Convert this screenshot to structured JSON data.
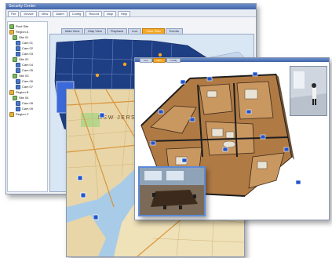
{
  "back_window": {
    "title": "Security Center",
    "toolbar_buttons": [
      "File",
      "Device",
      "View",
      "Alarm",
      "Config",
      "Record",
      "Map",
      "Help"
    ],
    "tabs": [
      "Main View",
      "Map View",
      "Playback",
      "Live",
      "Floor Plan",
      "Events"
    ],
    "active_tab_index": 4,
    "tree": [
      {
        "label": "Root Site",
        "type": "site"
      },
      {
        "label": "Region A",
        "type": "folder"
      },
      {
        "label": "Site 01",
        "type": "site"
      },
      {
        "label": "Cam 01",
        "type": "cam"
      },
      {
        "label": "Cam 02",
        "type": "cam"
      },
      {
        "label": "Cam 03",
        "type": "cam"
      },
      {
        "label": "Site 02",
        "type": "site"
      },
      {
        "label": "Cam 04",
        "type": "cam"
      },
      {
        "label": "Cam 05",
        "type": "cam"
      },
      {
        "label": "Site 03",
        "type": "site"
      },
      {
        "label": "Cam 06",
        "type": "cam"
      },
      {
        "label": "Cam 07",
        "type": "cam"
      },
      {
        "label": "Region B",
        "type": "folder"
      },
      {
        "label": "Site 04",
        "type": "site"
      },
      {
        "label": "Cam 08",
        "type": "cam"
      },
      {
        "label": "Cam 09",
        "type": "cam"
      },
      {
        "label": "Region C",
        "type": "folder"
      }
    ]
  },
  "map_window": {
    "place_label": "NEW JERSEY"
  },
  "floor_window": {
    "tabs": [
      "Live",
      "Plan",
      "Config"
    ],
    "active_tab_index": 1
  },
  "colors": {
    "titlebar": "#3f63a8",
    "accent_tab": "#f5a623",
    "us_map": "#1f3f85",
    "water": "#a8cbe8",
    "camera_marker": "#2255cc"
  }
}
